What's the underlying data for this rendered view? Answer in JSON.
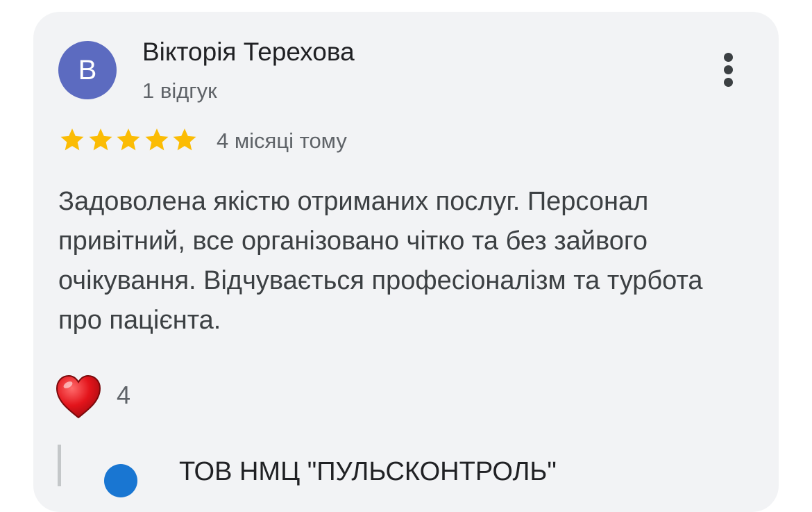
{
  "review": {
    "author": {
      "initial": "В",
      "name": "Вікторія Терехова",
      "review_count": "1 відгук",
      "avatar_color": "#5c6bc0"
    },
    "rating": 5,
    "rating_max": 5,
    "star_color": "#fbbc04",
    "date": "4 місяці тому",
    "text": "Задоволена якістю отриманих послуг. Персонал привітний, все організовано чітко та без зайвого очікування. Відчувається професіоналізм та турбота про пацієнта.",
    "reactions": {
      "icon": "heart-icon",
      "count": "4"
    },
    "more_icon": "more-vert-icon"
  },
  "owner_reply": {
    "name": "ТОВ НМЦ \"ПУЛЬСКОНТРОЛЬ\""
  }
}
